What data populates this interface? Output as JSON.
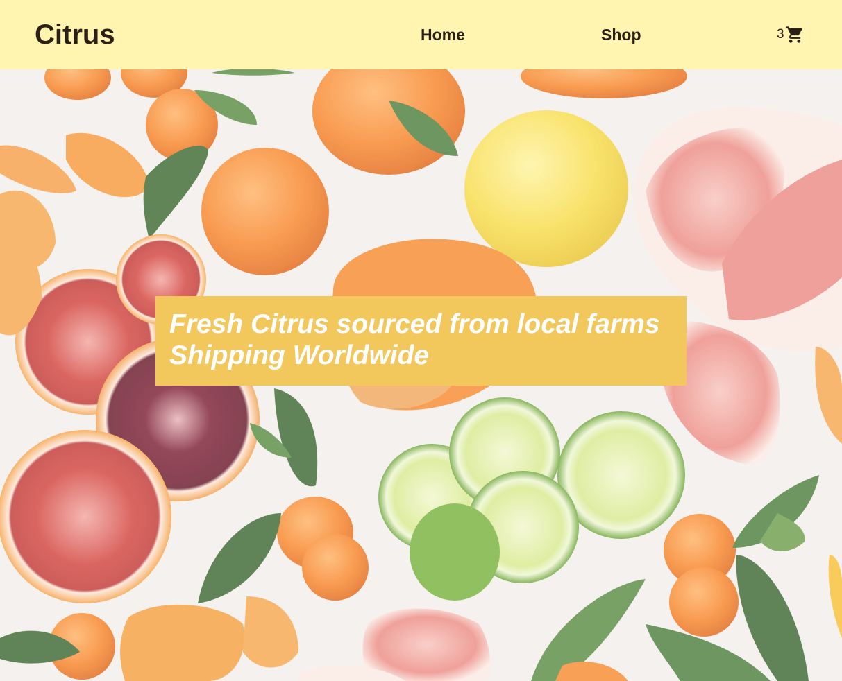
{
  "header": {
    "brand": "Citrus",
    "nav": {
      "home": "Home",
      "shop": "Shop"
    },
    "cart": {
      "count": "3",
      "icon": "shopping-cart-icon"
    },
    "background_color": "#fff4b0"
  },
  "hero": {
    "image": "citrus-fruits-photo",
    "banner": {
      "line1": "Fresh Citrus sourced from local farms",
      "line2": "Shipping Worldwide",
      "background_color": "#f2c75c",
      "text_color": "#ffffff"
    }
  }
}
